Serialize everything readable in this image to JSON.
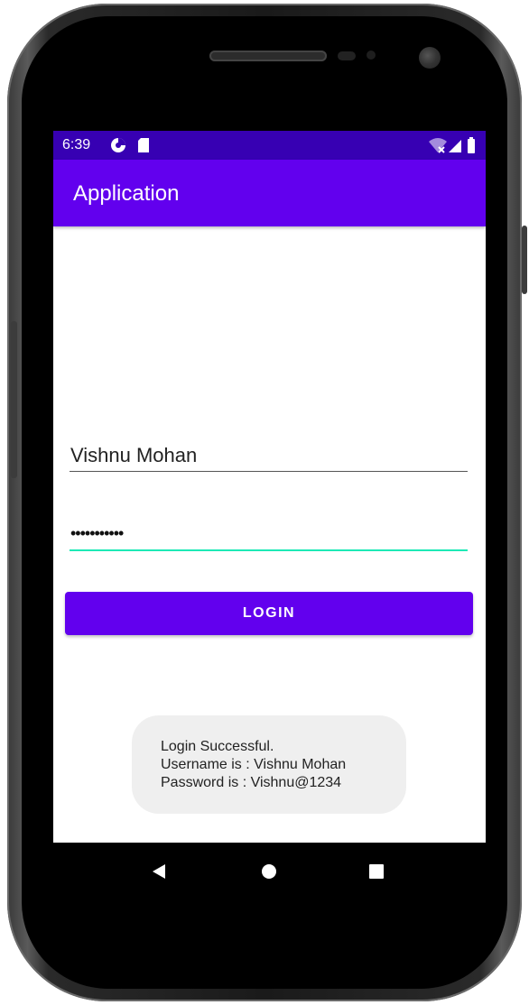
{
  "status_bar": {
    "time": "6:39",
    "icons": [
      "data-saver-icon",
      "sd-card-icon",
      "wifi-icon",
      "signal-icon",
      "battery-icon"
    ]
  },
  "app_bar": {
    "title": "Application"
  },
  "form": {
    "username_value": "Vishnu Mohan",
    "password_value": "•••••••••••",
    "login_label": "LOGIN"
  },
  "toast": {
    "line1": "Login Successful.",
    "line2": "Username is : Vishnu Mohan",
    "line3": "Password is : Vishnu@1234"
  },
  "nav_bar": {
    "icons": [
      "back-icon",
      "home-icon",
      "recents-icon"
    ]
  },
  "colors": {
    "status_bar": "#3700b3",
    "primary": "#6200ee",
    "focused_underline": "#1de9b6",
    "toast_bg": "#efefef"
  }
}
